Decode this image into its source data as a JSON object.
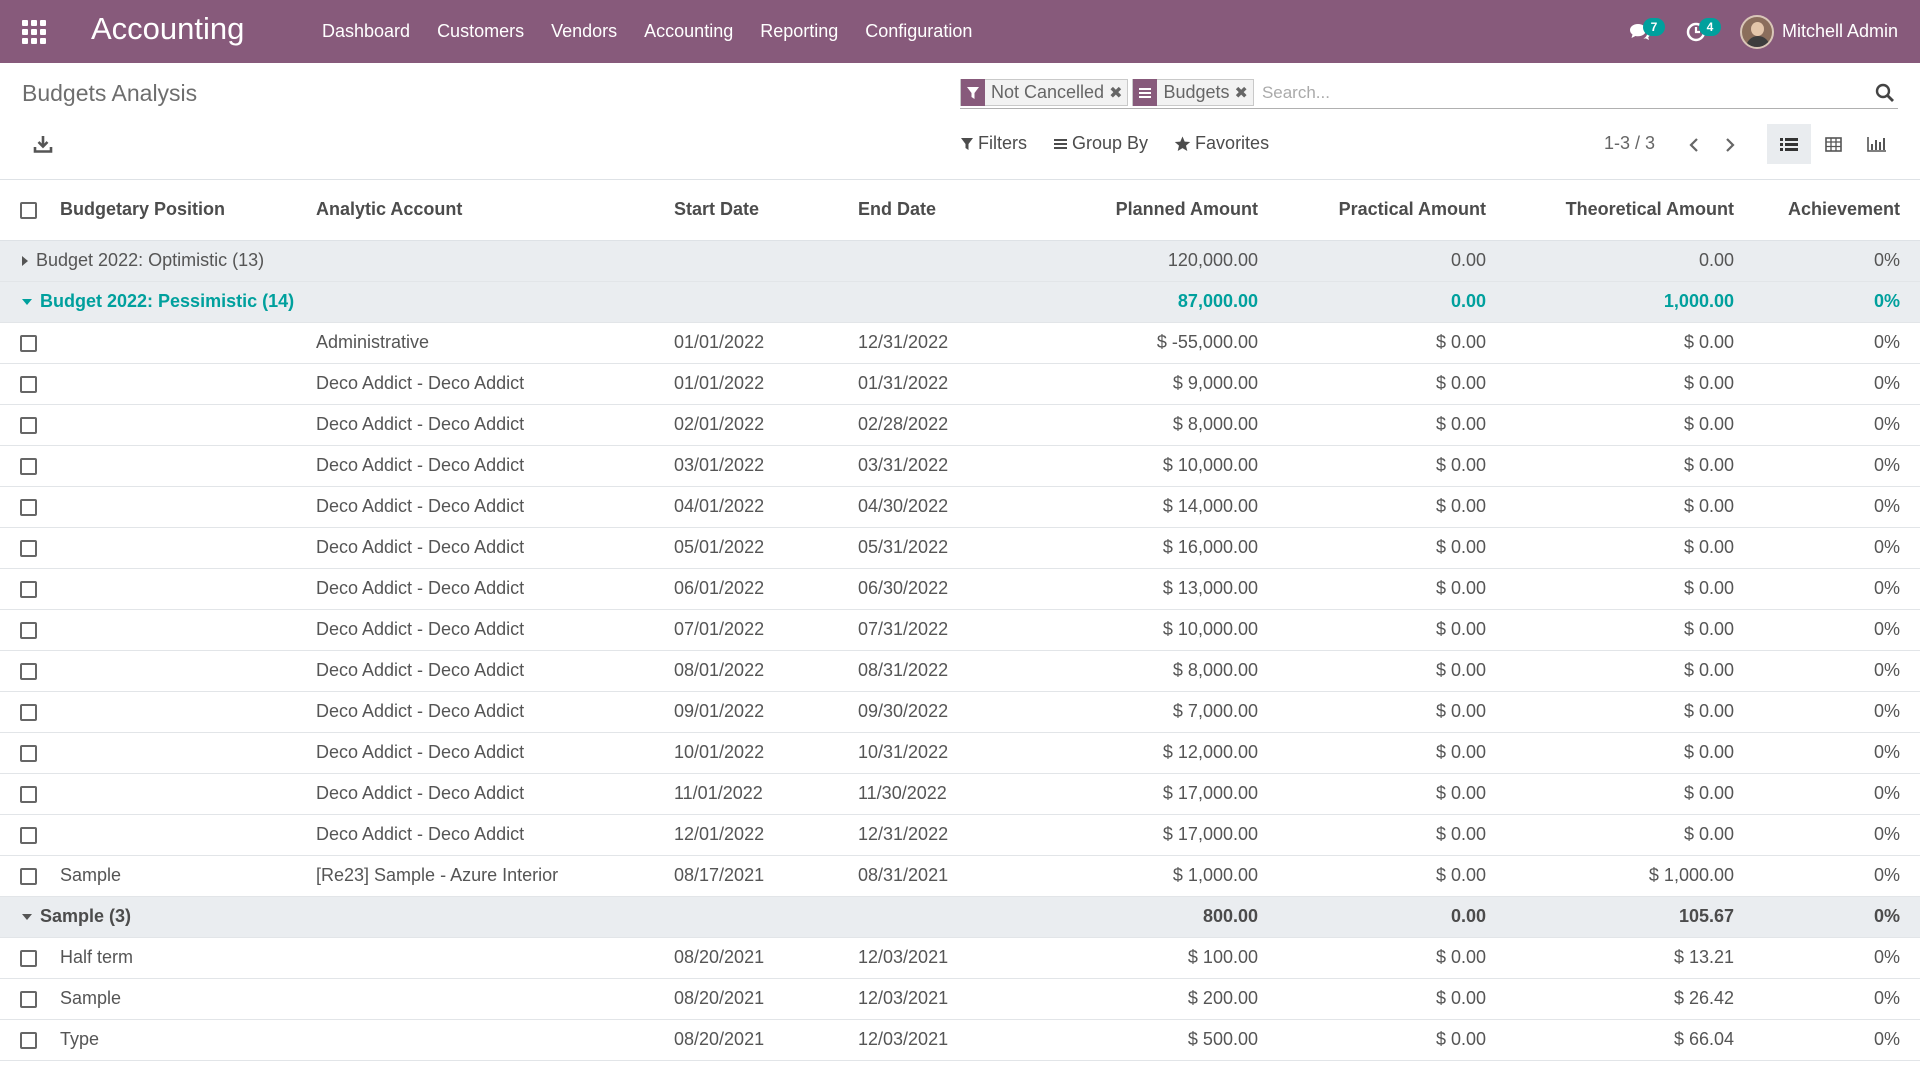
{
  "navbar": {
    "app_title": "Accounting",
    "menu": [
      "Dashboard",
      "Customers",
      "Vendors",
      "Accounting",
      "Reporting",
      "Configuration"
    ],
    "messages_count": "7",
    "activities_count": "4",
    "user_name": "Mitchell Admin"
  },
  "control": {
    "title": "Budgets Analysis",
    "facets": [
      {
        "label": "Not Cancelled",
        "icon": "filter-icon"
      },
      {
        "label": "Budgets",
        "icon": "group-by-icon"
      }
    ],
    "search_placeholder": "Search...",
    "filters_label": "Filters",
    "groupby_label": "Group By",
    "favorites_label": "Favorites",
    "pager": "1-3 / 3"
  },
  "table": {
    "headers": {
      "position": "Budgetary Position",
      "account": "Analytic Account",
      "start": "Start Date",
      "end": "End Date",
      "planned": "Planned Amount",
      "practical": "Practical Amount",
      "theoretical": "Theoretical Amount",
      "achievement": "Achievement"
    },
    "groups": [
      {
        "name": "Budget 2022: Optimistic (13)",
        "planned": "120,000.00",
        "practical": "0.00",
        "theoretical": "0.00",
        "achievement": "0%",
        "open": false
      },
      {
        "name": "Budget 2022: Pessimistic (14)",
        "planned": "87,000.00",
        "practical": "0.00",
        "theoretical": "1,000.00",
        "achievement": "0%",
        "open": true,
        "rows": [
          {
            "position": "",
            "account": "Administrative",
            "start": "01/01/2022",
            "end": "12/31/2022",
            "planned": "$ -55,000.00",
            "practical": "$ 0.00",
            "theoretical": "$ 0.00",
            "achievement": "0%"
          },
          {
            "position": "",
            "account": "Deco Addict - Deco Addict",
            "start": "01/01/2022",
            "end": "01/31/2022",
            "planned": "$ 9,000.00",
            "practical": "$ 0.00",
            "theoretical": "$ 0.00",
            "achievement": "0%"
          },
          {
            "position": "",
            "account": "Deco Addict - Deco Addict",
            "start": "02/01/2022",
            "end": "02/28/2022",
            "planned": "$ 8,000.00",
            "practical": "$ 0.00",
            "theoretical": "$ 0.00",
            "achievement": "0%"
          },
          {
            "position": "",
            "account": "Deco Addict - Deco Addict",
            "start": "03/01/2022",
            "end": "03/31/2022",
            "planned": "$ 10,000.00",
            "practical": "$ 0.00",
            "theoretical": "$ 0.00",
            "achievement": "0%"
          },
          {
            "position": "",
            "account": "Deco Addict - Deco Addict",
            "start": "04/01/2022",
            "end": "04/30/2022",
            "planned": "$ 14,000.00",
            "practical": "$ 0.00",
            "theoretical": "$ 0.00",
            "achievement": "0%"
          },
          {
            "position": "",
            "account": "Deco Addict - Deco Addict",
            "start": "05/01/2022",
            "end": "05/31/2022",
            "planned": "$ 16,000.00",
            "practical": "$ 0.00",
            "theoretical": "$ 0.00",
            "achievement": "0%"
          },
          {
            "position": "",
            "account": "Deco Addict - Deco Addict",
            "start": "06/01/2022",
            "end": "06/30/2022",
            "planned": "$ 13,000.00",
            "practical": "$ 0.00",
            "theoretical": "$ 0.00",
            "achievement": "0%"
          },
          {
            "position": "",
            "account": "Deco Addict - Deco Addict",
            "start": "07/01/2022",
            "end": "07/31/2022",
            "planned": "$ 10,000.00",
            "practical": "$ 0.00",
            "theoretical": "$ 0.00",
            "achievement": "0%"
          },
          {
            "position": "",
            "account": "Deco Addict - Deco Addict",
            "start": "08/01/2022",
            "end": "08/31/2022",
            "planned": "$ 8,000.00",
            "practical": "$ 0.00",
            "theoretical": "$ 0.00",
            "achievement": "0%"
          },
          {
            "position": "",
            "account": "Deco Addict - Deco Addict",
            "start": "09/01/2022",
            "end": "09/30/2022",
            "planned": "$ 7,000.00",
            "practical": "$ 0.00",
            "theoretical": "$ 0.00",
            "achievement": "0%"
          },
          {
            "position": "",
            "account": "Deco Addict - Deco Addict",
            "start": "10/01/2022",
            "end": "10/31/2022",
            "planned": "$ 12,000.00",
            "practical": "$ 0.00",
            "theoretical": "$ 0.00",
            "achievement": "0%"
          },
          {
            "position": "",
            "account": "Deco Addict - Deco Addict",
            "start": "11/01/2022",
            "end": "11/30/2022",
            "planned": "$ 17,000.00",
            "practical": "$ 0.00",
            "theoretical": "$ 0.00",
            "achievement": "0%"
          },
          {
            "position": "",
            "account": "Deco Addict - Deco Addict",
            "start": "12/01/2022",
            "end": "12/31/2022",
            "planned": "$ 17,000.00",
            "practical": "$ 0.00",
            "theoretical": "$ 0.00",
            "achievement": "0%"
          },
          {
            "position": "Sample",
            "account": "[Re23] Sample - Azure Interior",
            "start": "08/17/2021",
            "end": "08/31/2021",
            "planned": "$ 1,000.00",
            "practical": "$ 0.00",
            "theoretical": "$ 1,000.00",
            "achievement": "0%"
          }
        ]
      },
      {
        "name": "Sample (3)",
        "planned": "800.00",
        "practical": "0.00",
        "theoretical": "105.67",
        "achievement": "0%",
        "open": true,
        "rows": [
          {
            "position": "Half term",
            "account": "",
            "start": "08/20/2021",
            "end": "12/03/2021",
            "planned": "$ 100.00",
            "practical": "$ 0.00",
            "theoretical": "$ 13.21",
            "achievement": "0%"
          },
          {
            "position": "Sample",
            "account": "",
            "start": "08/20/2021",
            "end": "12/03/2021",
            "planned": "$ 200.00",
            "practical": "$ 0.00",
            "theoretical": "$ 26.42",
            "achievement": "0%"
          },
          {
            "position": "Type",
            "account": "",
            "start": "08/20/2021",
            "end": "12/03/2021",
            "planned": "$ 500.00",
            "practical": "$ 0.00",
            "theoretical": "$ 66.04",
            "achievement": "0%"
          }
        ]
      }
    ]
  },
  "colors": {
    "navbar": "#875a7b",
    "accent_teal": "#00a09d",
    "group_bg": "#eaedf0"
  }
}
